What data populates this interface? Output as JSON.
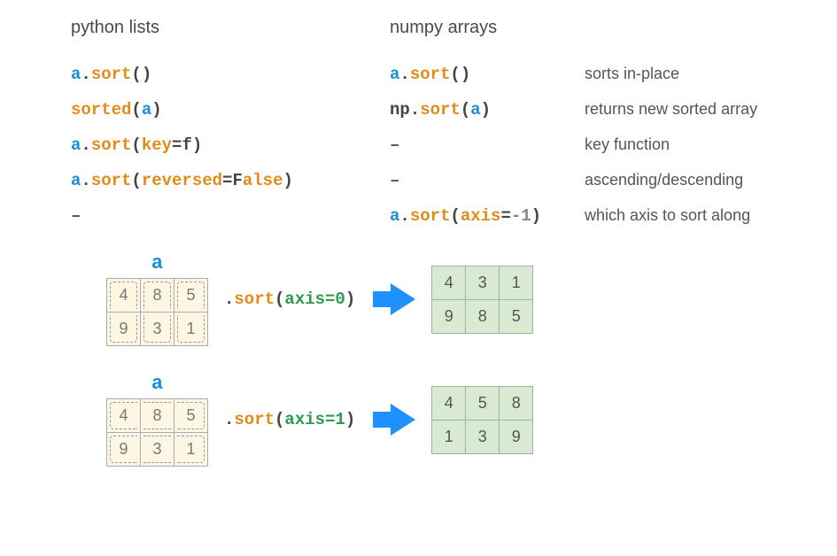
{
  "headers": {
    "left": "python lists",
    "mid": "numpy arrays"
  },
  "rows": [
    {
      "py": {
        "pre": "",
        "var": "a",
        "dot": ".",
        "func": "sort",
        "open": "(",
        "args": "",
        "close": ")"
      },
      "np": {
        "pre": "",
        "var": "a",
        "dot": ".",
        "func": "sort",
        "open": "(",
        "args": "",
        "close": ")"
      },
      "desc": "sorts in-place"
    },
    {
      "py": {
        "pre": "",
        "var": "",
        "dot": "",
        "func": "sorted",
        "open": "(",
        "args_var": "a",
        "close": ")"
      },
      "np": {
        "pre": "np",
        "predot": ".",
        "var": "",
        "dot": "",
        "func": "sort",
        "open": "(",
        "args_var": "a",
        "close": ")"
      },
      "desc": "returns new sorted array"
    },
    {
      "py": {
        "pre": "",
        "var": "a",
        "dot": ".",
        "func": "sort",
        "open": "(",
        "kw": "key",
        "eq": "=",
        "val": "f",
        "close": ")"
      },
      "np": null,
      "desc": "key function"
    },
    {
      "py": {
        "pre": "",
        "var": "a",
        "dot": ".",
        "func": "sort",
        "open": "(",
        "kw": "reversed",
        "eq": "=",
        "valF": "F",
        "valrest": "alse",
        "close": ")"
      },
      "np": null,
      "desc": "ascending/descending"
    },
    {
      "py": null,
      "np": {
        "pre": "",
        "var": "a",
        "dot": ".",
        "func": "sort",
        "open": "(",
        "kw": "axis",
        "eq": "=",
        "lit": "-1",
        "close": ")"
      },
      "desc": "which axis to sort along"
    }
  ],
  "diagrams": [
    {
      "label": "a",
      "mode": "col",
      "input": [
        [
          4,
          8,
          5
        ],
        [
          9,
          3,
          1
        ]
      ],
      "call": {
        "dot": ".",
        "func": "sort",
        "open": "(",
        "kw": "axis",
        "eq": "=",
        "val": "0",
        "close": ")"
      },
      "output": [
        [
          4,
          3,
          1
        ],
        [
          9,
          8,
          5
        ]
      ]
    },
    {
      "label": "a",
      "mode": "row",
      "input": [
        [
          4,
          8,
          5
        ],
        [
          9,
          3,
          1
        ]
      ],
      "call": {
        "dot": ".",
        "func": "sort",
        "open": "(",
        "kw": "axis",
        "eq": "=",
        "val": "1",
        "close": ")"
      },
      "output": [
        [
          4,
          5,
          8
        ],
        [
          1,
          3,
          9
        ]
      ]
    }
  ],
  "dash": "–"
}
